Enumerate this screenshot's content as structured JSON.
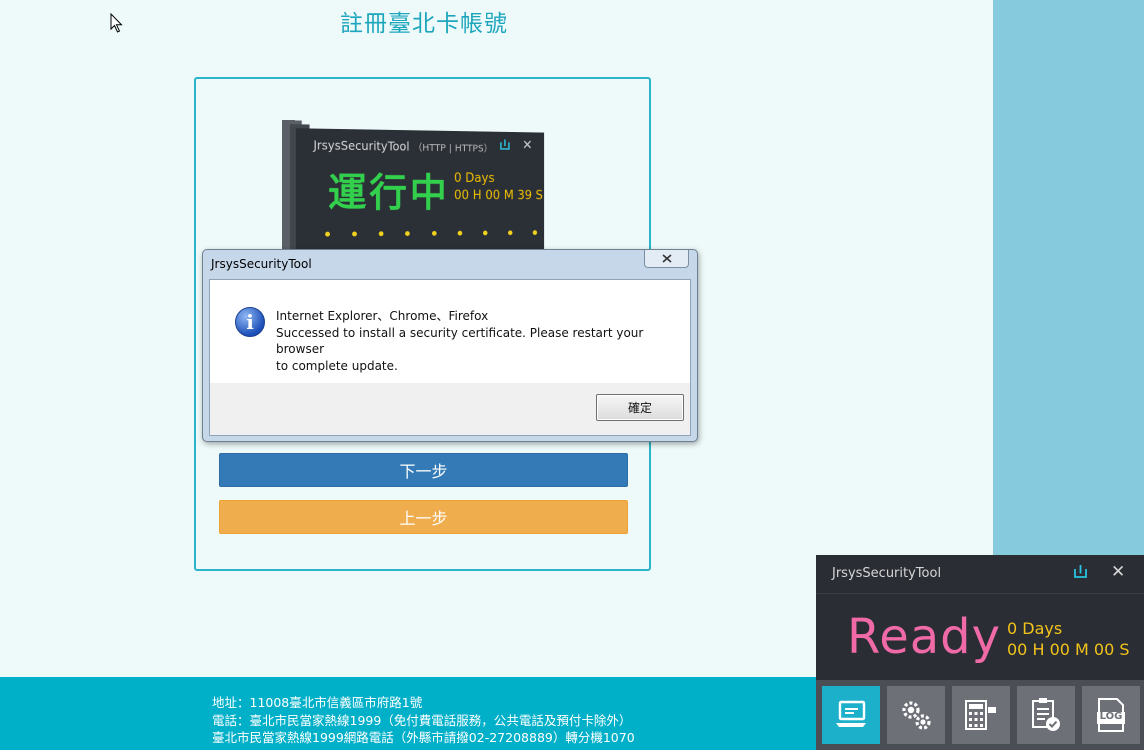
{
  "page": {
    "title": "註冊臺北卡帳號",
    "next_button": "下一步",
    "prev_button": "上一步"
  },
  "tool_preview": {
    "title": "JrsysSecurityTool",
    "protocol": "（HTTP | HTTPS）",
    "status": "運行中",
    "days": "0 Days",
    "time": "00 H 00 M 39 S"
  },
  "dialog": {
    "title": "JrsysSecurityTool",
    "line1": "Internet Explorer、Chrome、Firefox",
    "line2": "Successed to install a security certificate. Please restart your browser",
    "line3": "to complete update.",
    "ok_button": "確定"
  },
  "footer": {
    "address": "地址：11008臺北市信義區市府路1號",
    "phone": "電話：臺北市民當家熱線1999（免付費電話服務，公共電話及預付卡除外）",
    "hotline": "臺北市民當家熱線1999網路電話（外縣市請撥02-27208889）轉分機1070"
  },
  "widget": {
    "title": "JrsysSecurityTool",
    "status": "Ready",
    "days": "0 Days",
    "time": "00 H 00 M 00 S",
    "tiles": [
      "monitor-icon",
      "settings-icon",
      "calculator-icon",
      "checklist-icon",
      "log-icon"
    ],
    "tile_log_label": "LOG",
    "colors": {
      "status": "#f06aa7",
      "timer": "#f2c31b",
      "accent": "#1cb0cb"
    }
  }
}
